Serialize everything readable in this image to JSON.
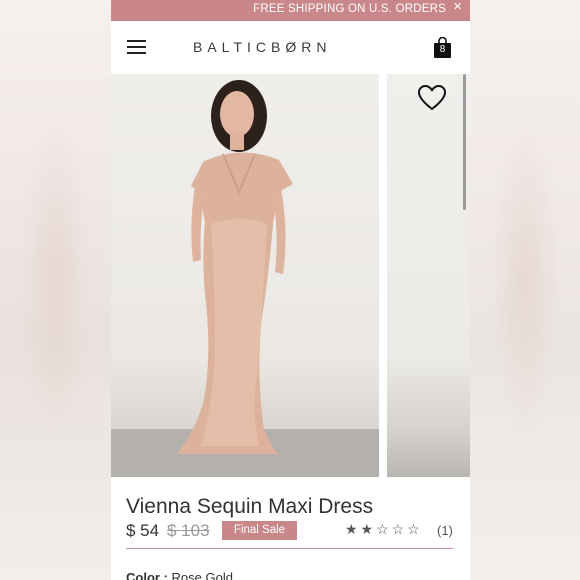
{
  "promo": {
    "text": "FREE SHIPPING ON U.S. ORDERS",
    "close": "×"
  },
  "header": {
    "logo": "BALTICBØRN",
    "cart_count": "8"
  },
  "product": {
    "title": "Vienna Sequin Maxi Dress",
    "price": "$ 54",
    "original_price": "$ 103",
    "badge": "Final Sale",
    "rating": 2,
    "rating_max": 5,
    "stars": "★★☆☆☆",
    "review_count": "(1)",
    "color_label": "Color :",
    "color_value": "Rose Gold"
  },
  "icons": {
    "menu": "hamburger-icon",
    "cart": "shopping-bag-icon",
    "wishlist": "heart-icon",
    "close": "close-icon"
  },
  "colors": {
    "accent": "#c9878a",
    "text": "#333333",
    "background": "#ffffff"
  }
}
